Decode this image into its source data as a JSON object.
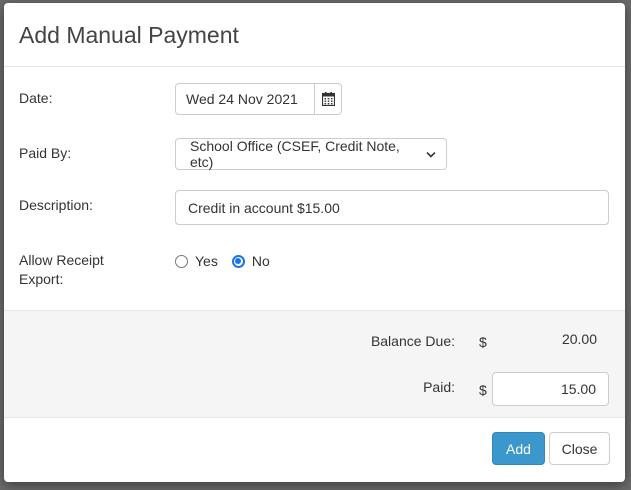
{
  "modal": {
    "title": "Add Manual Payment"
  },
  "form": {
    "date": {
      "label": "Date:",
      "value": "Wed 24 Nov 2021"
    },
    "paid_by": {
      "label": "Paid By:",
      "selected": "School Office (CSEF, Credit Note, etc)"
    },
    "description": {
      "label": "Description:",
      "value": "Credit in account $15.00"
    },
    "allow_receipt_export": {
      "label_line1": "Allow Receipt",
      "label_line2": "Export:",
      "options": [
        "Yes",
        "No"
      ],
      "selected": "No"
    }
  },
  "totals": {
    "balance_due_label": "Balance Due:",
    "balance_due_currency": "$",
    "balance_due_value": "20.00",
    "paid_label": "Paid:",
    "paid_currency": "$",
    "paid_value": "15.00"
  },
  "footer": {
    "add_label": "Add",
    "close_label": "Close"
  },
  "colors": {
    "primary_button": "#3c97cc",
    "radio_selected": "#1a73e8"
  },
  "icons": {
    "date_picker": "calendar-icon",
    "select_arrow": "chevron-down-icon"
  }
}
